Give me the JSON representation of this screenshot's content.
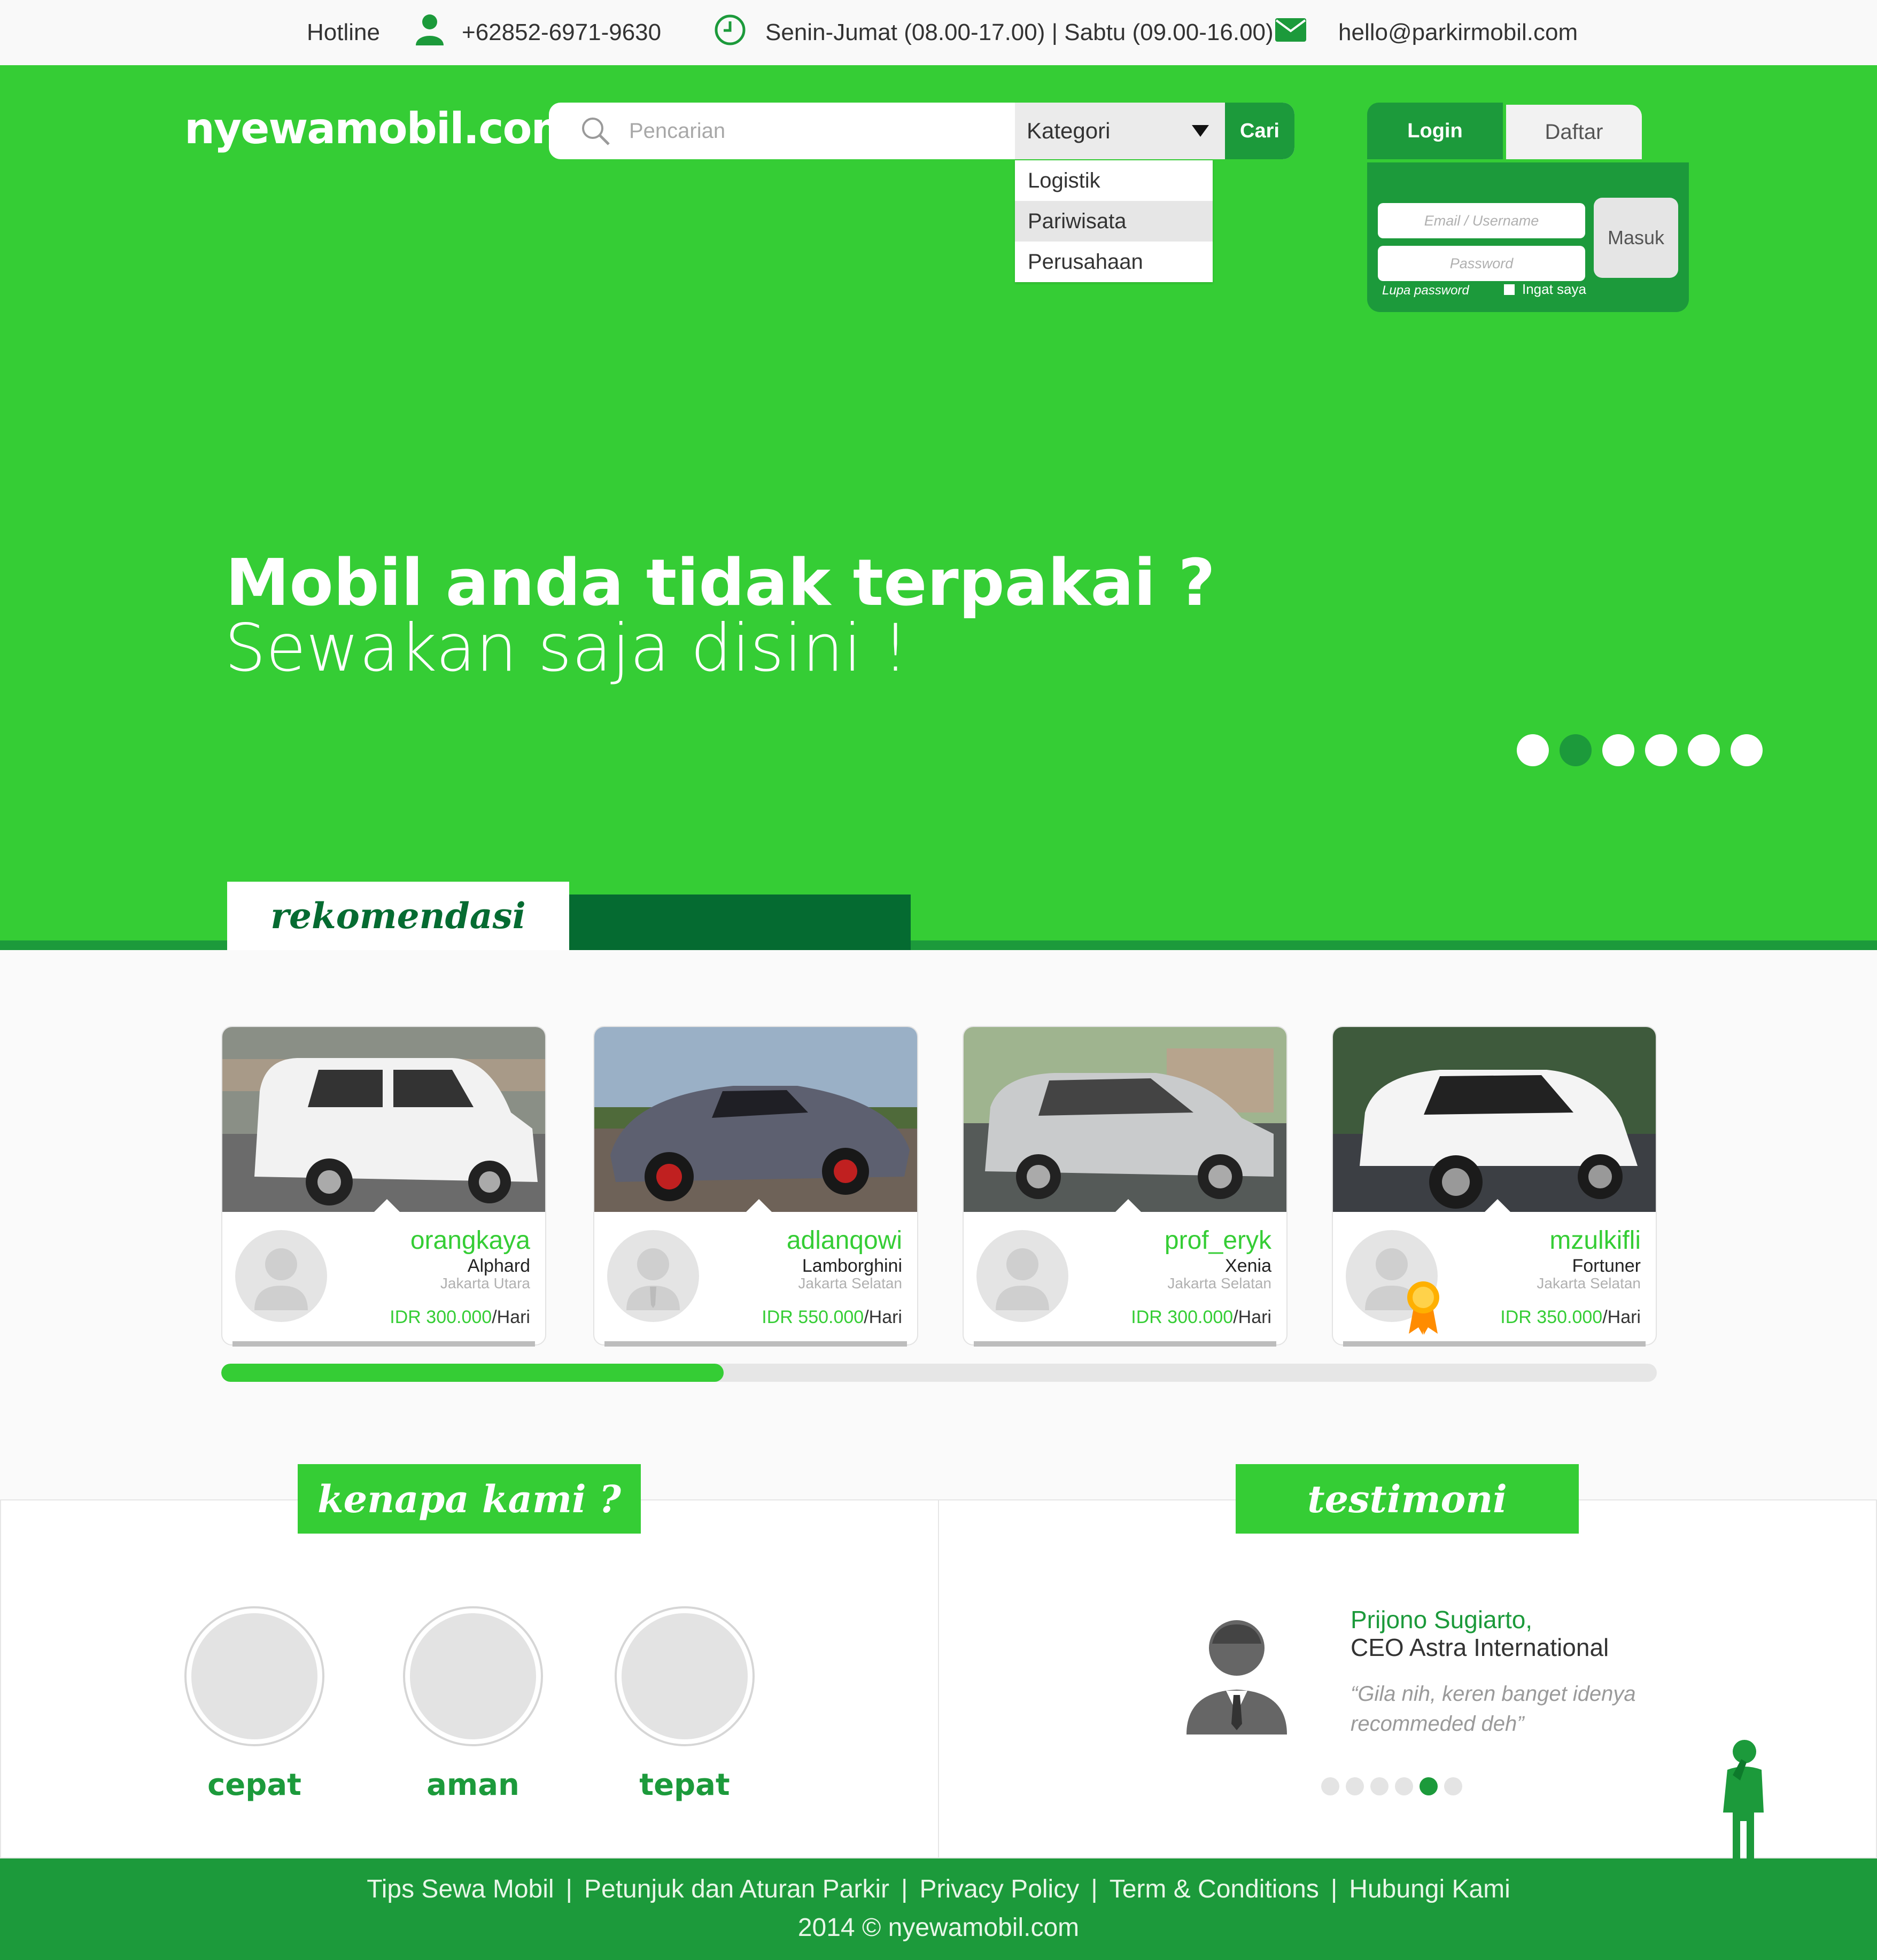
{
  "topbar": {
    "hotline_label": "Hotline",
    "phone": "+62852-6971-9630",
    "hours": "Senin-Jumat (08.00-17.00) | Sabtu (09.00-16.00)",
    "email": "hello@parkirmobil.com"
  },
  "header": {
    "logo": "nyewamobil.com",
    "search_placeholder": "Pencarian",
    "category_label": "Kategori",
    "search_button": "Cari",
    "categories": [
      "Logistik",
      "Pariwisata",
      "Perusahaan"
    ]
  },
  "auth": {
    "login_tab": "Login",
    "register_tab": "Daftar",
    "email_placeholder": "Email / Username",
    "password_placeholder": "Password",
    "submit": "Masuk",
    "forgot": "Lupa password",
    "remember": "Ingat saya"
  },
  "hero": {
    "title": "Mobil anda tidak terpakai ?",
    "subtitle": "Sewakan saja disini !",
    "slide_count": 6,
    "active_slide": 2
  },
  "recommendations": {
    "title": "rekomendasi",
    "scroll_progress": 0.35,
    "cards": [
      {
        "owner": "orangkaya",
        "car": "Alphard",
        "location": "Jakarta Utara",
        "price": "IDR 300.000",
        "per": "/Hari",
        "car_color": "#f2f2f2",
        "badge": false
      },
      {
        "owner": "adlanqowi",
        "car": "Lamborghini",
        "location": "Jakarta Selatan",
        "price": "IDR 550.000",
        "per": "/Hari",
        "car_color": "#5d6070",
        "badge": false
      },
      {
        "owner": "prof_eryk",
        "car": "Xenia",
        "location": "Jakarta Selatan",
        "price": "IDR 300.000",
        "per": "/Hari",
        "car_color": "#c9cbcc",
        "badge": false
      },
      {
        "owner": "mzulkifli",
        "car": "Fortuner",
        "location": "Jakarta Selatan",
        "price": "IDR 350.000",
        "per": "/Hari",
        "car_color": "#f4f4f4",
        "badge": true
      }
    ]
  },
  "why": {
    "title": "kenapa kami ?",
    "features": [
      "cepat",
      "aman",
      "tepat"
    ]
  },
  "testimonial": {
    "title": "testimoni",
    "name": "Prijono Sugiarto,",
    "role": "CEO Astra International",
    "quote": "“Gila nih, keren banget idenya recommeded deh”",
    "dot_count": 6,
    "active_dot": 5
  },
  "footer": {
    "links": [
      "Tips Sewa Mobil",
      "Petunjuk dan Aturan Parkir",
      "Privacy Policy",
      "Term & Conditions",
      "Hubungi Kami"
    ],
    "copyright": "2014 © nyewamobil.com"
  },
  "colors": {
    "brand_green": "#35cd35",
    "dark_green": "#1c9a3b",
    "deep_green": "#056b31"
  }
}
